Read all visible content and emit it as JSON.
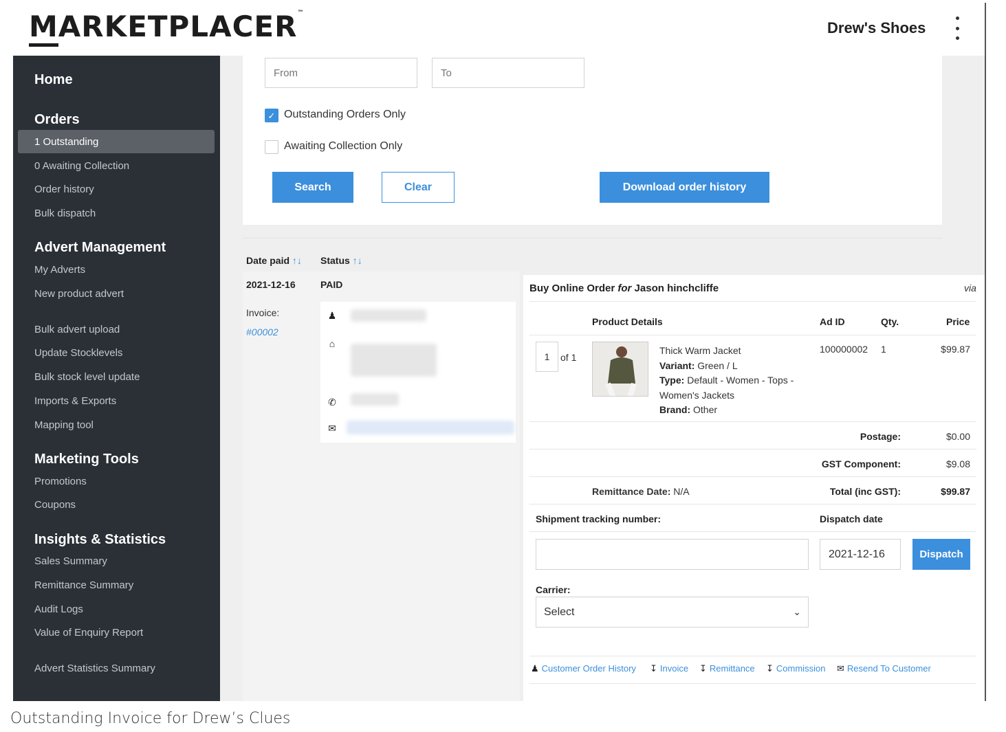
{
  "header": {
    "logo_text": "MARKETPLACER",
    "logo_first_letter": "M",
    "logo_rest": "ARKETPLACER",
    "logo_tm": "™",
    "shop_name": "Drew's Shoes",
    "menu_icon": "kebab-menu-icon"
  },
  "sidebar": {
    "home": "Home",
    "orders_heading": "Orders",
    "orders_items": [
      "1 Outstanding",
      "0 Awaiting Collection",
      "Order history",
      "Bulk dispatch"
    ],
    "advert_heading": "Advert Management",
    "advert_items": [
      "My Adverts",
      "New product advert",
      "Bulk advert upload",
      "Update Stocklevels",
      "Bulk stock level update",
      "Imports & Exports",
      "Mapping tool"
    ],
    "marketing_heading": "Marketing Tools",
    "marketing_items": [
      "Promotions",
      "Coupons"
    ],
    "insights_heading": "Insights & Statistics",
    "insights_items": [
      "Sales Summary",
      "Remittance Summary",
      "Audit Logs",
      "Value of Enquiry Report",
      "Advert Statistics Summary"
    ]
  },
  "filters": {
    "from_placeholder": "From",
    "to_placeholder": "To",
    "outstanding_only_label": "Outstanding Orders Only",
    "outstanding_only_checked": true,
    "awaiting_collection_label": "Awaiting Collection Only",
    "awaiting_collection_checked": false,
    "search_label": "Search",
    "clear_label": "Clear",
    "download_label": "Download order history"
  },
  "table": {
    "col_date": "Date paid",
    "col_status": "Status",
    "sort_arrows": "↑↓"
  },
  "order": {
    "date_paid": "2021-12-16",
    "status": "PAID",
    "invoice_label": "Invoice:",
    "invoice_number": "#00002",
    "contact_icons": [
      "person-icon",
      "home-icon",
      "phone-icon",
      "envelope-icon"
    ]
  },
  "detail": {
    "title_prefix": "Buy Online Order",
    "title_for": "for",
    "customer": "Jason hinchcliffe",
    "via": "via",
    "headers": {
      "product": "Product Details",
      "ad_id": "Ad ID",
      "qty": "Qty.",
      "price": "Price"
    },
    "item": {
      "index": "1",
      "of": "of 1",
      "name": "Thick Warm Jacket",
      "variant_label": "Variant:",
      "variant": "Green / L",
      "type_label": "Type:",
      "type": "Default - Women - Tops - Women's Jackets",
      "brand_label": "Brand:",
      "brand": "Other",
      "ad_id": "100000002",
      "qty": "1",
      "price": "$99.87"
    },
    "postage_label": "Postage:",
    "postage": "$0.00",
    "gst_label": "GST Component:",
    "gst": "$9.08",
    "remittance_label": "Remittance Date:",
    "remittance": "N/A",
    "total_label": "Total (inc GST):",
    "total": "$99.87",
    "tracking_label": "Shipment tracking number:",
    "dispatch_date_label": "Dispatch date",
    "dispatch_date": "2021-12-16",
    "dispatch_button": "Dispatch",
    "carrier_label": "Carrier:",
    "carrier_value": "Select",
    "footer_links": [
      "Customer Order History",
      "Invoice",
      "Remittance",
      "Commission",
      "Resend To Customer"
    ]
  },
  "caption": "Outstanding Invoice for Drew’s Clues",
  "colors": {
    "accent": "#3b8fdc",
    "sidebar_bg": "#2a3036",
    "sidebar_active": "#5b6166"
  }
}
